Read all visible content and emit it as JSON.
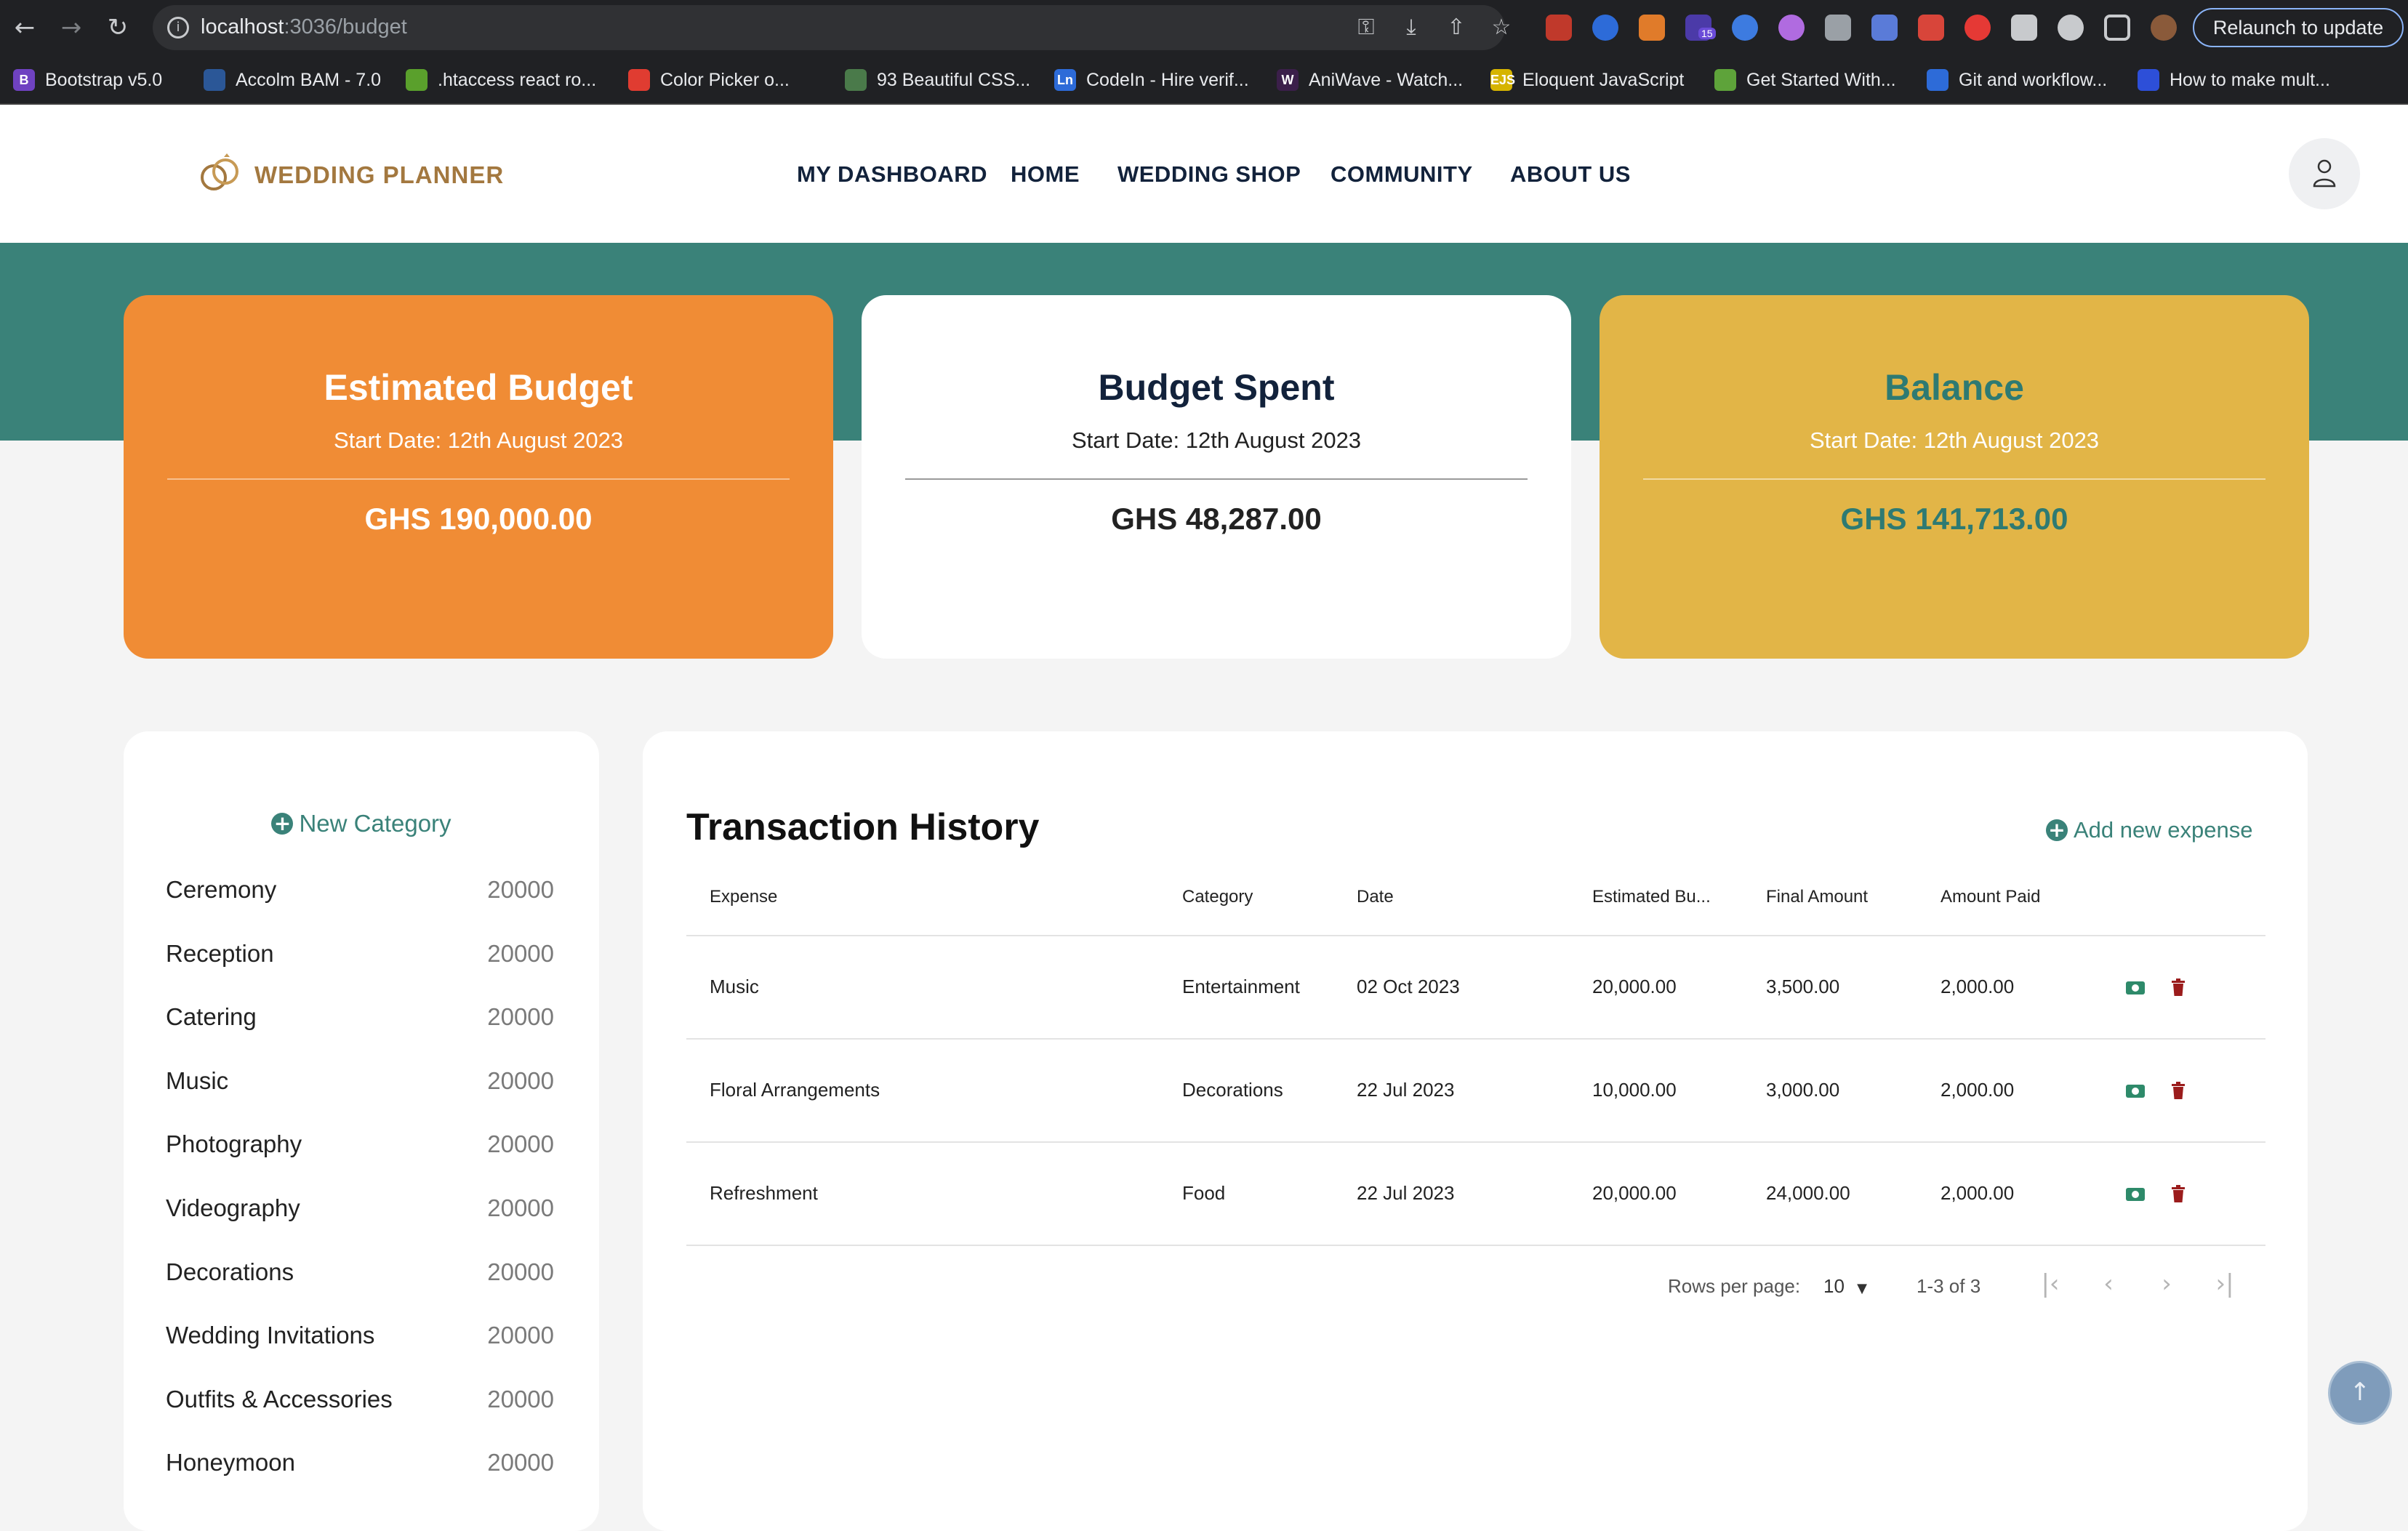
{
  "browser": {
    "url_host": "localhost",
    "url_path": ":3036/budget",
    "relaunch_label": "Relaunch to update",
    "extension_badge": "15",
    "bookmarks": [
      {
        "label": "Bootstrap v5.0",
        "fav": "B",
        "color": "#6f42c1"
      },
      {
        "label": "Accolm BAM - 7.0",
        "fav": "",
        "color": "#2b5797"
      },
      {
        "label": ".htaccess react ro...",
        "fav": "",
        "color": "#5aa02c"
      },
      {
        "label": "Color Picker o...",
        "fav": "",
        "color": "#e03c31"
      },
      {
        "label": "93 Beautiful CSS...",
        "fav": "",
        "color": "#4a7a4a"
      },
      {
        "label": "CodeIn - Hire verif...",
        "fav": "Ln",
        "color": "#2d6bd8"
      },
      {
        "label": "AniWave - Watch...",
        "fav": "W",
        "color": "#3b1f4a"
      },
      {
        "label": "Eloquent JavaScript",
        "fav": "EJS",
        "color": "#d6b400"
      },
      {
        "label": "Get Started With...",
        "fav": "",
        "color": "#5ea33a"
      },
      {
        "label": "Git and workflow...",
        "fav": "",
        "color": "#2d6bd8"
      },
      {
        "label": "How to make mult...",
        "fav": "",
        "color": "#2d4fd8"
      }
    ]
  },
  "header": {
    "logo_text": "WEDDING PLANNER",
    "nav": [
      "MY DASHBOARD",
      "HOME",
      "WEDDING SHOP",
      "COMMUNITY",
      "ABOUT US"
    ]
  },
  "cards": {
    "estimated": {
      "title": "Estimated Budget",
      "subtitle": "Start Date: 12th August 2023",
      "amount": "GHS 190,000.00",
      "bg": "#f08c35"
    },
    "spent": {
      "title": "Budget Spent",
      "subtitle": "Start Date: 12th August 2023",
      "amount": "GHS 48,287.00",
      "bg": "#ffffff"
    },
    "balance": {
      "title": "Balance",
      "subtitle": "Start Date: 12th August 2023",
      "amount": "GHS 141,713.00",
      "bg": "#e2b547"
    }
  },
  "categories": {
    "new_label": "New Category",
    "items": [
      {
        "name": "Ceremony",
        "value": "20000"
      },
      {
        "name": "Reception",
        "value": "20000"
      },
      {
        "name": "Catering",
        "value": "20000"
      },
      {
        "name": "Music",
        "value": "20000"
      },
      {
        "name": "Photography",
        "value": "20000"
      },
      {
        "name": "Videography",
        "value": "20000"
      },
      {
        "name": "Decorations",
        "value": "20000"
      },
      {
        "name": "Wedding Invitations",
        "value": "20000"
      },
      {
        "name": "Outfits & Accessories",
        "value": "20000"
      },
      {
        "name": "Honeymoon",
        "value": "20000"
      }
    ]
  },
  "transactions": {
    "title": "Transaction History",
    "add_label": "Add new expense",
    "columns": [
      "Expense",
      "Category",
      "Date",
      "Estimated Bu...",
      "Final Amount",
      "Amount Paid"
    ],
    "rows": [
      [
        "Music",
        "Entertainment",
        "02 Oct 2023",
        "20,000.00",
        "3,500.00",
        "2,000.00"
      ],
      [
        "Floral Arrangements",
        "Decorations",
        "22 Jul 2023",
        "10,000.00",
        "3,000.00",
        "2,000.00"
      ],
      [
        "Refreshment",
        "Food",
        "22 Jul 2023",
        "20,000.00",
        "24,000.00",
        "2,000.00"
      ]
    ],
    "rows_per_page_label": "Rows per page:",
    "rows_per_page": "10",
    "page_range": "1-3 of 3"
  },
  "colors": {
    "teal": "#3a8279",
    "orange": "#f08c35",
    "gold": "#e2b547",
    "navy": "#12223b"
  }
}
